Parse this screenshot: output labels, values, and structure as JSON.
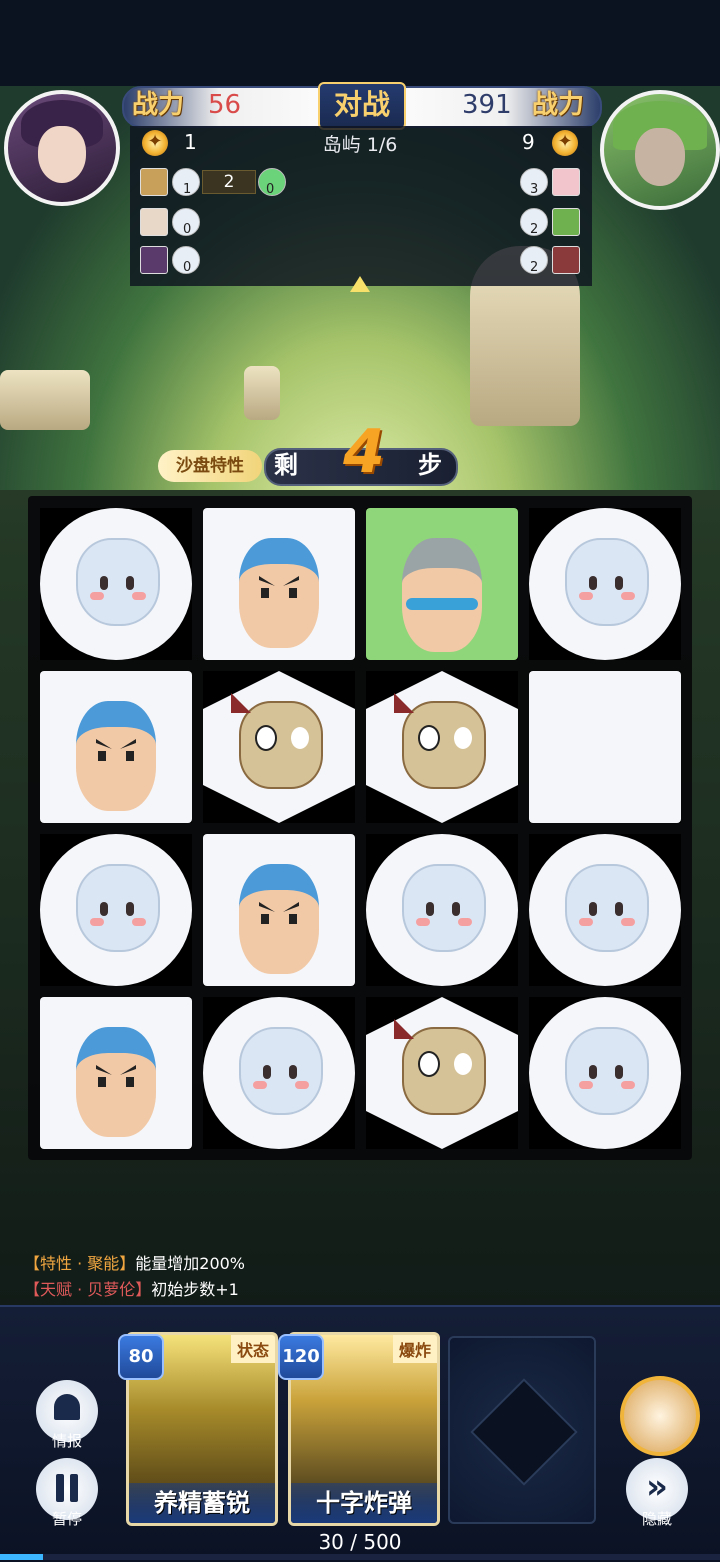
{
  "header": {
    "left_power_label": "战力",
    "left_power_value": "56",
    "vs_label": "对战",
    "right_power_value": "391",
    "right_power_label": "战力",
    "left_score": "1",
    "island": "岛屿 1/6",
    "right_score": "9"
  },
  "units": {
    "left": [
      {
        "badge1": "1",
        "slot": "2",
        "badge2": "0"
      },
      {
        "badge1": "0"
      },
      {
        "badge1": "0"
      }
    ],
    "right": [
      {
        "badge": "3"
      },
      {
        "badge": "2"
      },
      {
        "badge": "2"
      }
    ]
  },
  "steps": {
    "sand_label": "沙盘特性",
    "prefix": "剩",
    "count": "4",
    "suffix": "步"
  },
  "board": {
    "rows": 4,
    "cols": 4,
    "cells": [
      {
        "shape": "circle",
        "face": "ghost"
      },
      {
        "shape": "square",
        "face": "soldier"
      },
      {
        "shape": "highlight",
        "face": "helmet"
      },
      {
        "shape": "circle",
        "face": "ghost"
      },
      {
        "shape": "square",
        "face": "soldier"
      },
      {
        "shape": "hex",
        "face": "dragon"
      },
      {
        "shape": "hex",
        "face": "dragon"
      },
      {
        "shape": "square",
        "face": "none"
      },
      {
        "shape": "circle",
        "face": "ghost"
      },
      {
        "shape": "square",
        "face": "soldier"
      },
      {
        "shape": "circle",
        "face": "ghost"
      },
      {
        "shape": "circle",
        "face": "ghost"
      },
      {
        "shape": "square",
        "face": "soldier"
      },
      {
        "shape": "circle",
        "face": "ghost"
      },
      {
        "shape": "hex",
        "face": "dragon"
      },
      {
        "shape": "circle",
        "face": "ghost"
      }
    ]
  },
  "log": [
    {
      "tag": "【特性 · 聚能】",
      "text": "能量增加200%"
    },
    {
      "tag": "【天赋 · 贝萝伦】",
      "text": "初始步数+1"
    }
  ],
  "controls": {
    "info_label": "情报",
    "pause_label": "暂停",
    "hide_label": "隐藏",
    "hide_icon": "»"
  },
  "cards": [
    {
      "cost": "80",
      "tag": "状态",
      "name": "养精蓄锐"
    },
    {
      "cost": "120",
      "tag": "爆炸",
      "name": "十字炸弹"
    }
  ],
  "energy": {
    "text": "30 / 500",
    "fraction": 0.06
  }
}
